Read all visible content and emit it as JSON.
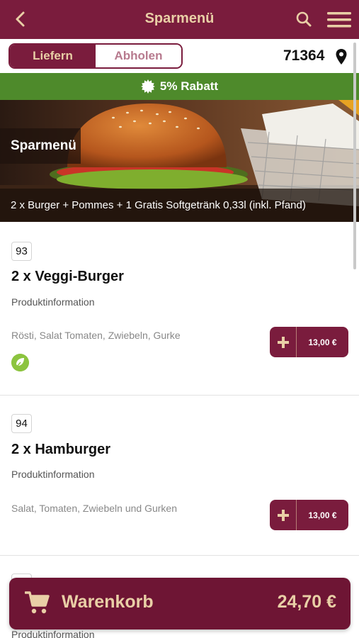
{
  "header": {
    "title": "Sparmenü",
    "back_icon": "chevron-left-icon",
    "search_icon": "search-icon",
    "menu_icon": "hamburger-menu-icon"
  },
  "mode": {
    "options": [
      "Liefern",
      "Abholen"
    ],
    "selected": "Liefern",
    "postal_code": "71364"
  },
  "discount_banner": {
    "text": "5% Rabatt"
  },
  "category": {
    "name": "Sparmenü",
    "description": "2 x Burger + Pommes + 1 Gratis Softgetränk 0,33l (inkl. Pfand)"
  },
  "products": [
    {
      "number": "93",
      "name": "2 x Veggi-Burger",
      "info_label": "Produktinformation",
      "ingredients": "Rösti, Salat Tomaten, Zwiebeln, Gurke",
      "vegetarian": true,
      "price": "13,00 €"
    },
    {
      "number": "94",
      "name": "2 x Hamburger",
      "info_label": "Produktinformation",
      "ingredients": "Salat, Tomaten, Zwiebeln und Gurken",
      "vegetarian": false,
      "price": "13,00 €"
    },
    {
      "info_label": "Produktinformation"
    }
  ],
  "cart": {
    "label": "Warenkorb",
    "total": "24,70 €"
  },
  "colors": {
    "brand": "#7a1c3d",
    "brand_text": "#e9cfa6",
    "discount_green": "#4e8a2b",
    "veg_green": "#8cc43f"
  }
}
